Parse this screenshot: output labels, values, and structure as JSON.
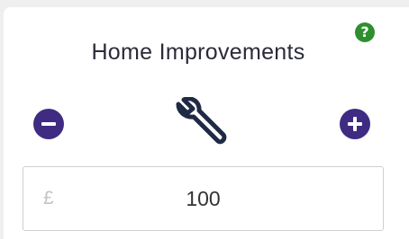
{
  "card": {
    "title": "Home Improvements",
    "help_icon": "question-icon",
    "help_glyph": "?",
    "decrease_icon": "minus-icon",
    "increase_icon": "plus-icon",
    "category_icon": "wrench-icon",
    "amount": {
      "currency_symbol": "£",
      "value": "100"
    }
  },
  "colors": {
    "accent": "#3f2b82",
    "help": "#2f8f2f",
    "icon": "#1f2a44"
  }
}
